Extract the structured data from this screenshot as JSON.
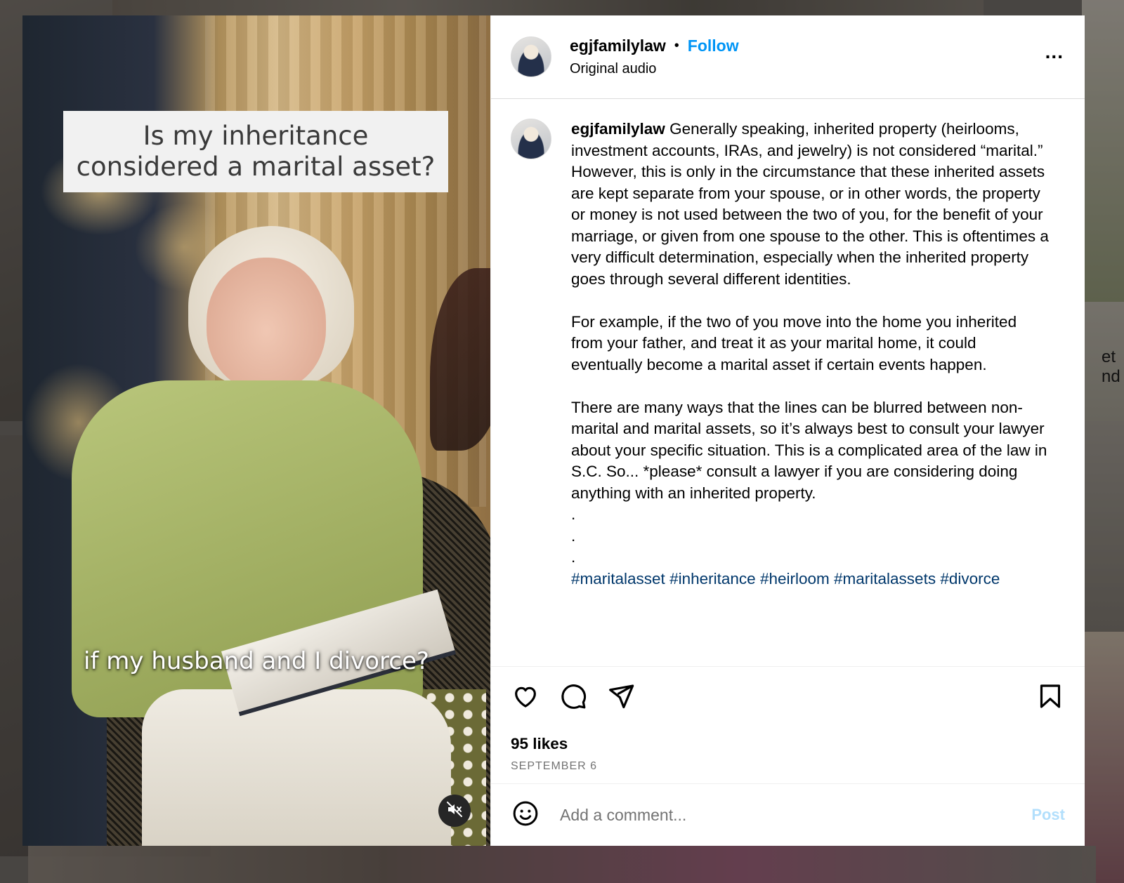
{
  "video": {
    "overlay_title": "Is my inheritance considered a marital asset?",
    "caption": "if my husband and I divorce?",
    "mute_icon": "speaker-muted-icon"
  },
  "header": {
    "username": "egjfamilylaw",
    "separator": "•",
    "follow_label": "Follow",
    "audio_label": "Original audio",
    "more_icon": "more-options-icon",
    "more_label": "..."
  },
  "post": {
    "username": "egjfamilylaw",
    "caption": "Generally speaking, inherited property (heirlooms, investment accounts, IRAs, and jewelry) is not considered “marital.” However, this is only in the circumstance that these inherited assets are kept separate from your spouse, or in other words, the property or money is not used between the two of you, for the benefit of your marriage, or given from one spouse to the other. This is oftentimes a very difficult determination, especially when the inherited property goes through several different identities.\n\nFor example, if the two of you move into the home you inherited from your father, and treat it as your marital home, it could eventually become a marital asset if certain events happen.\n\nThere are many ways that the lines can be blurred between non-marital and marital assets, so it’s always best to consult your lawyer about your specific situation. This is a complicated area of the law in S.C. So... *please* consult a lawyer if you are considering doing anything with an inherited property.\n.\n.\n.\n",
    "hashtags": [
      "#maritalasset",
      "#inheritance",
      "#heirloom",
      "#maritalassets",
      "#divorce"
    ]
  },
  "actions": {
    "like_icon": "heart-icon",
    "comment_icon": "comment-icon",
    "share_icon": "share-icon",
    "save_icon": "bookmark-icon"
  },
  "stats": {
    "likes": "95 likes",
    "date": "SEPTEMBER 6"
  },
  "comment": {
    "emoji_icon": "emoji-icon",
    "placeholder": "Add a comment...",
    "post_label": "Post"
  },
  "background": {
    "peek_text": "et\nnd"
  },
  "colors": {
    "follow": "#0095f6",
    "hashtag": "#00376b",
    "post_disabled": "#b2dffc",
    "muted_text": "#737373"
  }
}
